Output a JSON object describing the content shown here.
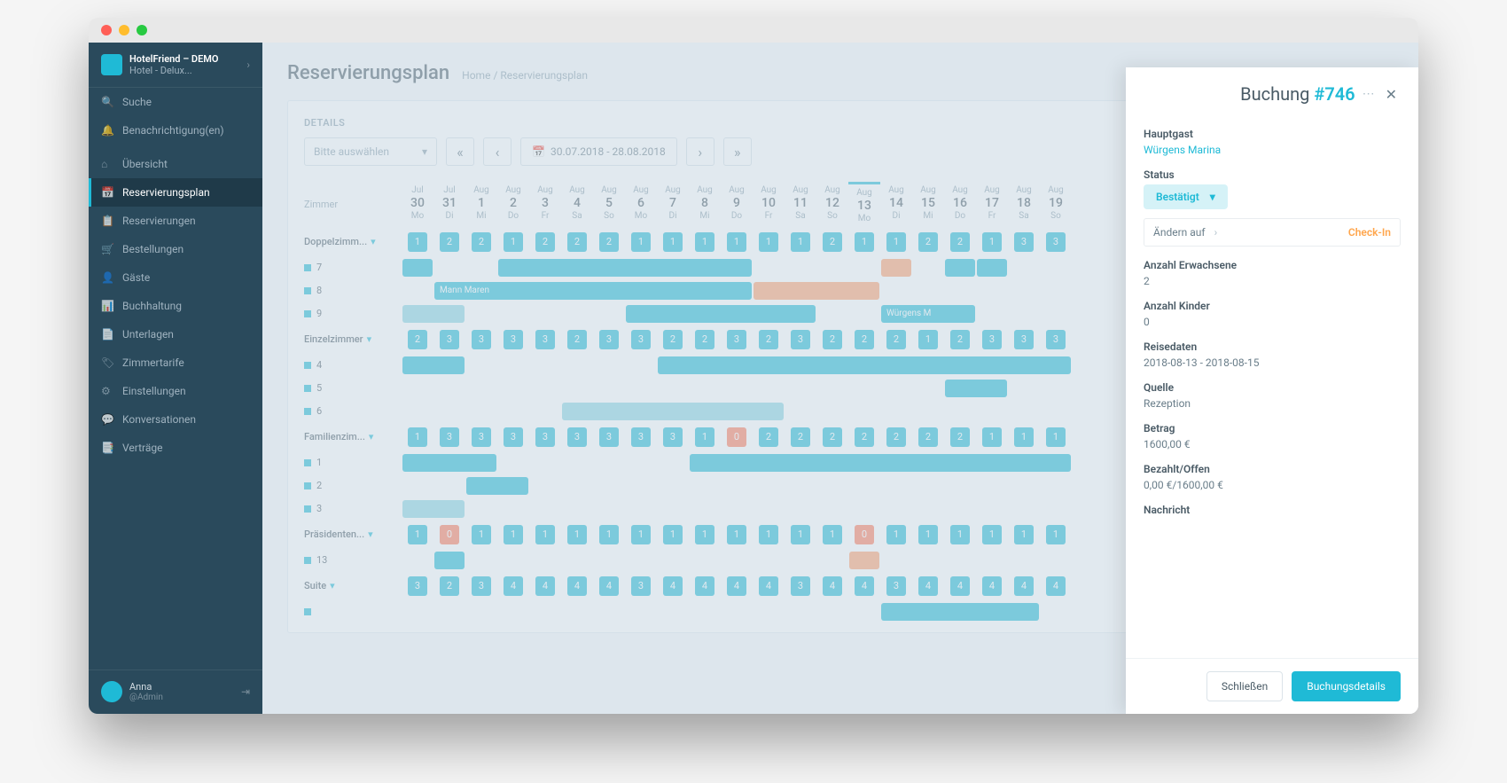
{
  "app_name": "HotelFriend – DEMO",
  "hotel_name": "Hotel - Delux...",
  "sidebar": {
    "search": "Suche",
    "notifications": "Benachrichtigung(en)",
    "items": [
      {
        "label": "Übersicht"
      },
      {
        "label": "Reservierungsplan"
      },
      {
        "label": "Reservierungen"
      },
      {
        "label": "Bestellungen"
      },
      {
        "label": "Gäste"
      },
      {
        "label": "Buchhaltung"
      },
      {
        "label": "Unterlagen"
      },
      {
        "label": "Zimmertarife"
      },
      {
        "label": "Einstellungen"
      },
      {
        "label": "Konversationen"
      },
      {
        "label": "Verträge"
      }
    ],
    "user": {
      "name": "Anna",
      "role": "@Admin"
    }
  },
  "page": {
    "title": "Reservierungsplan",
    "breadcrumb_home": "Home",
    "breadcrumb_current": "Reservierungsplan",
    "details_label": "DETAILS",
    "select_placeholder": "Bitte auswählen",
    "daterange": "30.07.2018 - 28.08.2018",
    "zimmer_label": "Zimmer"
  },
  "calendar": {
    "today_index": 14,
    "days": [
      {
        "mon": "Jul",
        "num": "30",
        "dow": "Mo"
      },
      {
        "mon": "Jul",
        "num": "31",
        "dow": "Di"
      },
      {
        "mon": "Aug",
        "num": "1",
        "dow": "Mi"
      },
      {
        "mon": "Aug",
        "num": "2",
        "dow": "Do"
      },
      {
        "mon": "Aug",
        "num": "3",
        "dow": "Fr"
      },
      {
        "mon": "Aug",
        "num": "4",
        "dow": "Sa"
      },
      {
        "mon": "Aug",
        "num": "5",
        "dow": "So"
      },
      {
        "mon": "Aug",
        "num": "6",
        "dow": "Mo"
      },
      {
        "mon": "Aug",
        "num": "7",
        "dow": "Di"
      },
      {
        "mon": "Aug",
        "num": "8",
        "dow": "Mi"
      },
      {
        "mon": "Aug",
        "num": "9",
        "dow": "Do"
      },
      {
        "mon": "Aug",
        "num": "10",
        "dow": "Fr"
      },
      {
        "mon": "Aug",
        "num": "11",
        "dow": "Sa"
      },
      {
        "mon": "Aug",
        "num": "12",
        "dow": "So"
      },
      {
        "mon": "Aug",
        "num": "13",
        "dow": "Mo"
      },
      {
        "mon": "Aug",
        "num": "14",
        "dow": "Di"
      },
      {
        "mon": "Aug",
        "num": "15",
        "dow": "Mi"
      },
      {
        "mon": "Aug",
        "num": "16",
        "dow": "Do"
      },
      {
        "mon": "Aug",
        "num": "17",
        "dow": "Fr"
      },
      {
        "mon": "Aug",
        "num": "18",
        "dow": "Sa"
      },
      {
        "mon": "Aug",
        "num": "19",
        "dow": "So"
      }
    ],
    "groups": [
      {
        "name": "Doppelzimm...",
        "avail": [
          1,
          2,
          2,
          1,
          2,
          2,
          2,
          1,
          1,
          1,
          1,
          1,
          1,
          2,
          1,
          1,
          2,
          2,
          1,
          3,
          3
        ],
        "rooms": [
          {
            "num": "7",
            "bars": [
              {
                "start": 0,
                "span": 1,
                "text": "",
                "cls": ""
              },
              {
                "start": 3,
                "span": 8,
                "text": "",
                "cls": ""
              },
              {
                "start": 15,
                "span": 1,
                "text": "",
                "cls": "orange"
              },
              {
                "start": 17,
                "span": 1,
                "text": "",
                "cls": ""
              },
              {
                "start": 18,
                "span": 1,
                "text": "",
                "cls": ""
              }
            ]
          },
          {
            "num": "8",
            "bars": [
              {
                "start": 1,
                "span": 10,
                "text": "Mann Maren",
                "cls": ""
              },
              {
                "start": 11,
                "span": 4,
                "text": "",
                "cls": "orange"
              }
            ]
          },
          {
            "num": "9",
            "bars": [
              {
                "start": 0,
                "span": 2,
                "text": "",
                "cls": "light"
              },
              {
                "start": 7,
                "span": 6,
                "text": "",
                "cls": ""
              },
              {
                "start": 15,
                "span": 3,
                "text": "Würgens M",
                "cls": ""
              }
            ]
          }
        ]
      },
      {
        "name": "Einzelzimmer",
        "avail": [
          2,
          3,
          3,
          3,
          3,
          2,
          3,
          3,
          2,
          2,
          3,
          2,
          3,
          2,
          2,
          2,
          1,
          2,
          3,
          3,
          3
        ],
        "rooms": [
          {
            "num": "4",
            "bars": [
              {
                "start": 0,
                "span": 2,
                "text": "",
                "cls": ""
              },
              {
                "start": 8,
                "span": 13,
                "text": "",
                "cls": ""
              }
            ]
          },
          {
            "num": "5",
            "bars": [
              {
                "start": 17,
                "span": 2,
                "text": "",
                "cls": ""
              }
            ]
          },
          {
            "num": "6",
            "bars": [
              {
                "start": 5,
                "span": 7,
                "text": "",
                "cls": "light"
              }
            ]
          }
        ]
      },
      {
        "name": "Familienzim...",
        "avail": [
          1,
          3,
          3,
          3,
          3,
          3,
          3,
          3,
          3,
          1,
          0,
          2,
          2,
          2,
          2,
          2,
          2,
          2,
          1,
          1,
          1
        ],
        "avail_warn": [
          10
        ],
        "rooms": [
          {
            "num": "1",
            "bars": [
              {
                "start": 0,
                "span": 3,
                "text": "",
                "cls": ""
              },
              {
                "start": 9,
                "span": 12,
                "text": "",
                "cls": ""
              }
            ]
          },
          {
            "num": "2",
            "bars": [
              {
                "start": 2,
                "span": 2,
                "text": "",
                "cls": ""
              }
            ]
          },
          {
            "num": "3",
            "bars": [
              {
                "start": 0,
                "span": 2,
                "text": "",
                "cls": "light"
              }
            ]
          }
        ]
      },
      {
        "name": "Präsidenten...",
        "avail": [
          1,
          0,
          1,
          1,
          1,
          1,
          1,
          1,
          1,
          1,
          1,
          1,
          1,
          1,
          0,
          1,
          1,
          1,
          1,
          1,
          1
        ],
        "avail_warn": [
          1,
          14
        ],
        "rooms": [
          {
            "num": "13",
            "bars": [
              {
                "start": 1,
                "span": 1,
                "text": "",
                "cls": ""
              },
              {
                "start": 14,
                "span": 1,
                "text": "",
                "cls": "orange"
              }
            ]
          }
        ]
      },
      {
        "name": "Suite",
        "avail": [
          3,
          2,
          3,
          4,
          4,
          4,
          4,
          3,
          4,
          4,
          4,
          4,
          3,
          4,
          4,
          3,
          4,
          4,
          4,
          4,
          4
        ],
        "rooms": [
          {
            "num": "",
            "bars": [
              {
                "start": 15,
                "span": 5,
                "text": "",
                "cls": ""
              }
            ]
          }
        ]
      }
    ]
  },
  "panel": {
    "title_prefix": "Buchung",
    "title_number": "#746",
    "fields": {
      "hauptgast_label": "Hauptgast",
      "hauptgast_value": "Würgens Marina",
      "status_label": "Status",
      "status_value": "Bestätigt",
      "change_label": "Ändern auf",
      "checkin_label": "Check-In",
      "adults_label": "Anzahl Erwachsene",
      "adults_value": "2",
      "children_label": "Anzahl Kinder",
      "children_value": "0",
      "travel_label": "Reisedaten",
      "travel_value": "2018-08-13 - 2018-08-15",
      "source_label": "Quelle",
      "source_value": "Rezeption",
      "amount_label": "Betrag",
      "amount_value": "1600,00 €",
      "paid_label": "Bezahlt/Offen",
      "paid_value": "0,00 €/1600,00 €",
      "note_label": "Nachricht"
    },
    "close_btn": "Schließen",
    "details_btn": "Buchungsdetails"
  }
}
